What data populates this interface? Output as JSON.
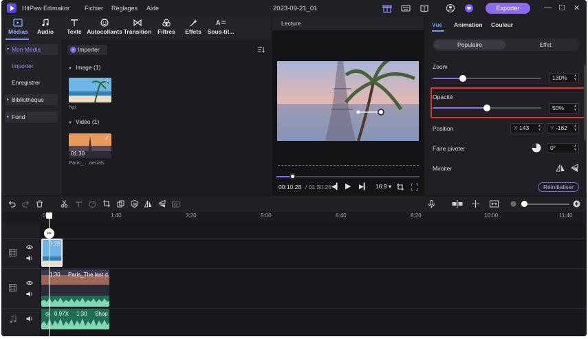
{
  "app": {
    "name": "HitPaw Edimakor",
    "menus": [
      "Fichier",
      "Réglages",
      "Aide"
    ],
    "document_title": "2023-09-21_01",
    "export_label": "Exporter",
    "accent": "#8b6cf0"
  },
  "media_tabs": [
    {
      "label": "Médias",
      "icon": "media-icon"
    },
    {
      "label": "Audio",
      "icon": "music-note-icon"
    },
    {
      "label": "Texte",
      "icon": "text-icon"
    },
    {
      "label": "Autocollants",
      "icon": "sticker-icon"
    },
    {
      "label": "Transition",
      "icon": "transition-icon"
    },
    {
      "label": "Filtres",
      "icon": "filter-icon"
    },
    {
      "label": "Effets",
      "icon": "effects-icon"
    },
    {
      "label": "Sous-tit...",
      "icon": "subtitle-icon"
    }
  ],
  "sidebar": {
    "items": [
      {
        "label": "Mon Média"
      },
      {
        "label": "Importer"
      },
      {
        "label": "Enregistrer"
      },
      {
        "label": "Bibliothèque"
      },
      {
        "label": "Fond"
      }
    ]
  },
  "media": {
    "import_label": "Importer",
    "image_section": "Image  (1)",
    "video_section": "Vidéo  (1)",
    "image_caption": "hqi",
    "video_caption": "Paris_ ...aerials",
    "video_duration": "01:30"
  },
  "preview": {
    "title": "Lecture",
    "current_time": "00:10:28",
    "total_time": "/ 01:30:26",
    "aspect": "16:9",
    "progress": 0.11
  },
  "properties": {
    "tabs": [
      "Vue",
      "Animation",
      "Couleur"
    ],
    "segments": [
      "Populaire",
      "Effet"
    ],
    "zoom_label": "Zoom",
    "zoom_value": "130%",
    "zoom_level": 0.28,
    "opacity_label": "Opacité",
    "opacity_value": "50%",
    "opacity_level": 0.5,
    "position_label": "Position",
    "position_x_prefix": "X",
    "position_x": "143",
    "position_y_prefix": "Y",
    "position_y": "-162",
    "rotate_label": "Faire pivoter",
    "rotate_value": "0°",
    "mirror_label": "Miroiter",
    "reset_label": "Réinitialiser",
    "highlight_color": "#e3332f"
  },
  "timeline": {
    "ticks": [
      "00",
      "1:40",
      "3:20",
      "5:00",
      "6:40",
      "8:20",
      "10:00",
      "11:40"
    ],
    "image_clip_label": "1:28",
    "video_clip_time": "1:30",
    "video_clip_name": "Paris_The last d",
    "audio_clip_speed": "0.97X",
    "audio_clip_time": "1:30",
    "audio_clip_name": "Shop"
  }
}
